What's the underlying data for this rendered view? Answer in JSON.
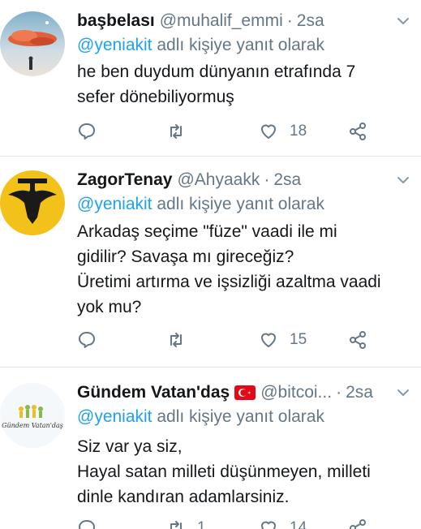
{
  "tweets": [
    {
      "name": "başbelası",
      "handle": "@muhalif_emmi",
      "time": "2sa",
      "reply_prefix": "@yeniakit",
      "reply_suffix": " adlı kişiye yanıt olarak",
      "lines": [
        "he ben duydum dünyanın etrafında 7",
        "sefer dönebiliyormuş"
      ],
      "likes": "18",
      "retweets": ""
    },
    {
      "name": "ZagorTenay",
      "handle": "@Ahyaakk",
      "time": "2sa",
      "reply_prefix": "@yeniakit",
      "reply_suffix": " adlı kişiye yanıt olarak",
      "lines": [
        "Arkadaş seçime \"füze\" vaadi ile mi",
        "gidilir? Savaşa mı gireceğiz?",
        "Üretimi artırma ve işsizliği azaltma vaadi",
        "yok mu?"
      ],
      "likes": "15",
      "retweets": ""
    },
    {
      "name": "Gündem Vatan'daş",
      "handle": "@bitcoi...",
      "time": "2sa",
      "reply_prefix": "@yeniakit",
      "reply_suffix": " adlı kişiye yanıt olarak",
      "lines": [
        "Siz var ya siz,",
        "Hayal satan milleti düşünmeyen, milleti",
        "dinle kandıran adamlarsiniz."
      ],
      "likes": "14",
      "retweets": "1",
      "avatar_text": "Gündem Vatan'daş",
      "flag": "turkey-flag"
    }
  ],
  "colors": {
    "accent": "#1da1f2",
    "muted": "#657786",
    "text": "#14171a",
    "divider": "#e1e8ed"
  }
}
